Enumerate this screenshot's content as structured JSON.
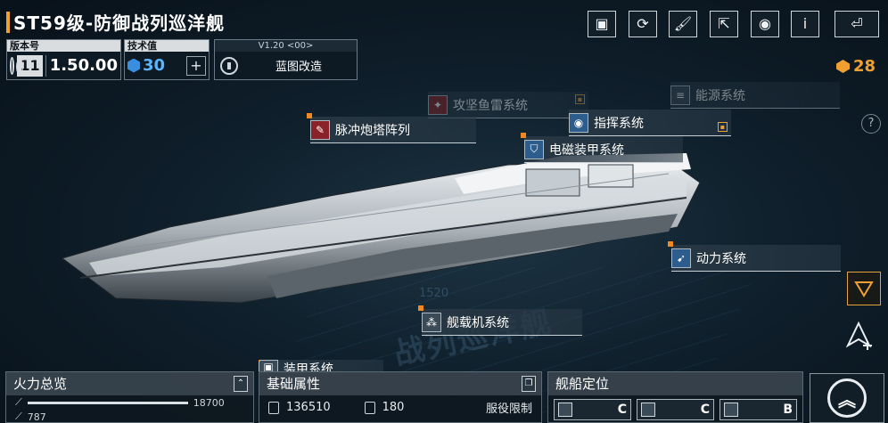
{
  "title": "ST59级-防御战列巡洋舰",
  "version_box": {
    "label": "版本号",
    "level": "11",
    "value": "1.50.00"
  },
  "tech_box": {
    "label": "技术值",
    "value": "30",
    "plus": "+"
  },
  "blueprint_box": {
    "version": "V1.20 <00>",
    "label": "蓝图改造"
  },
  "top_buttons": [
    {
      "name": "ship-view-icon",
      "glyph": "▣"
    },
    {
      "name": "refresh-icon",
      "glyph": "⟳"
    },
    {
      "name": "paint-icon",
      "glyph": "🖌"
    },
    {
      "name": "share-icon",
      "glyph": "⇱"
    },
    {
      "name": "eye-icon",
      "glyph": "◉"
    },
    {
      "name": "info-icon",
      "glyph": "i"
    },
    {
      "name": "back-icon",
      "glyph": "⏎"
    }
  ],
  "currency": {
    "value": "28"
  },
  "help": "?",
  "systems": {
    "torpedo": "攻坚鱼雷系统",
    "energy": "能源系统",
    "command": "指挥系统",
    "pulse": "脉冲炮塔阵列",
    "em_armor": "电磁装甲系统",
    "power": "动力系统",
    "carrier": "舰载机系统",
    "armor": "装甲系统"
  },
  "watermark": "战列巡洋舰",
  "watermark_num": "1520",
  "panels": {
    "firepower": {
      "title": "火力总览",
      "max": "18700",
      "second": "787",
      "fill": 1.0,
      "fill2": 0.05
    },
    "base": {
      "title": "基础属性",
      "hp": "136510",
      "armor": "180",
      "note": "服役限制"
    },
    "position": {
      "title": "舰船定位",
      "grades": [
        "C",
        "C",
        "B"
      ]
    }
  },
  "colors": {
    "accent": "#f0a030",
    "panel": "#0e1820"
  }
}
